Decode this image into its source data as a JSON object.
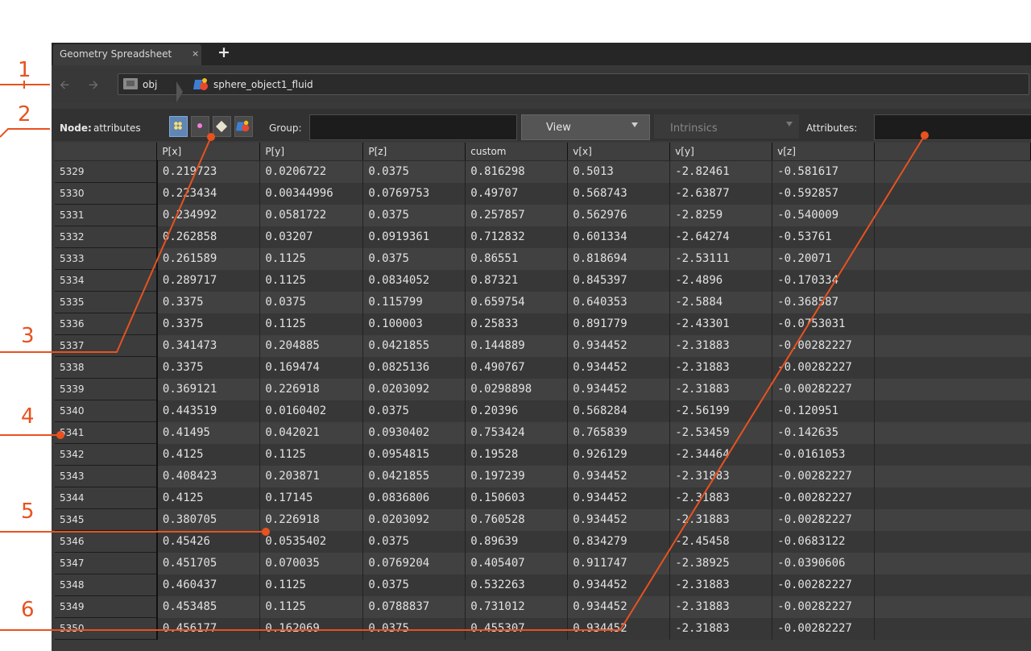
{
  "tab": {
    "label": "Geometry Spreadsheet",
    "close_glyph": "×",
    "add_glyph": "+"
  },
  "nav": {
    "back_icon": "arrow-left-icon",
    "forward_icon": "arrow-right-icon"
  },
  "path": {
    "root_label": "obj",
    "node_label": "sphere_object1_fluid"
  },
  "options": {
    "node_label": "Node:",
    "node_value": "attributes",
    "group_label": "Group:",
    "group_value": "",
    "view_label": "View",
    "intrinsics_label": "Intrinsics",
    "attributes_label": "Attributes:",
    "attributes_value": ""
  },
  "table": {
    "columns": [
      "P[x]",
      "P[y]",
      "P[z]",
      "custom",
      "v[x]",
      "v[y]",
      "v[z]"
    ],
    "rows": [
      {
        "id": "5329",
        "values": [
          "0.219723",
          "0.0206722",
          "0.0375",
          "0.816298",
          "0.5013",
          "-2.82461",
          "-0.581617"
        ]
      },
      {
        "id": "5330",
        "values": [
          "0.223434",
          "0.00344996",
          "0.0769753",
          "0.49707",
          "0.568743",
          "-2.63877",
          "-0.592857"
        ]
      },
      {
        "id": "5331",
        "values": [
          "0.234992",
          "0.0581722",
          "0.0375",
          "0.257857",
          "0.562976",
          "-2.8259",
          "-0.540009"
        ]
      },
      {
        "id": "5332",
        "values": [
          "0.262858",
          "0.03207",
          "0.0919361",
          "0.712832",
          "0.601334",
          "-2.64274",
          "-0.53761"
        ]
      },
      {
        "id": "5333",
        "values": [
          "0.261589",
          "0.1125",
          "0.0375",
          "0.86551",
          "0.818694",
          "-2.53111",
          "-0.20071"
        ]
      },
      {
        "id": "5334",
        "values": [
          "0.289717",
          "0.1125",
          "0.0834052",
          "0.87321",
          "0.845397",
          "-2.4896",
          "-0.170334"
        ]
      },
      {
        "id": "5335",
        "values": [
          "0.3375",
          "0.0375",
          "0.115799",
          "0.659754",
          "0.640353",
          "-2.5884",
          "-0.368587"
        ]
      },
      {
        "id": "5336",
        "values": [
          "0.3375",
          "0.1125",
          "0.100003",
          "0.25833",
          "0.891779",
          "-2.43301",
          "-0.0753031"
        ]
      },
      {
        "id": "5337",
        "values": [
          "0.341473",
          "0.204885",
          "0.0421855",
          "0.144889",
          "0.934452",
          "-2.31883",
          "-0.00282227"
        ]
      },
      {
        "id": "5338",
        "values": [
          "0.3375",
          "0.169474",
          "0.0825136",
          "0.490767",
          "0.934452",
          "-2.31883",
          "-0.00282227"
        ]
      },
      {
        "id": "5339",
        "values": [
          "0.369121",
          "0.226918",
          "0.0203092",
          "0.0298898",
          "0.934452",
          "-2.31883",
          "-0.00282227"
        ]
      },
      {
        "id": "5340",
        "values": [
          "0.443519",
          "0.0160402",
          "0.0375",
          "0.20396",
          "0.568284",
          "-2.56199",
          "-0.120951"
        ]
      },
      {
        "id": "5341",
        "values": [
          "0.41495",
          "0.042021",
          "0.0930402",
          "0.753424",
          "0.765839",
          "-2.53459",
          "-0.142635"
        ]
      },
      {
        "id": "5342",
        "values": [
          "0.4125",
          "0.1125",
          "0.0954815",
          "0.19528",
          "0.926129",
          "-2.34464",
          "-0.0161053"
        ]
      },
      {
        "id": "5343",
        "values": [
          "0.408423",
          "0.203871",
          "0.0421855",
          "0.197239",
          "0.934452",
          "-2.31883",
          "-0.00282227"
        ]
      },
      {
        "id": "5344",
        "values": [
          "0.4125",
          "0.17145",
          "0.0836806",
          "0.150603",
          "0.934452",
          "-2.31883",
          "-0.00282227"
        ]
      },
      {
        "id": "5345",
        "values": [
          "0.380705",
          "0.226918",
          "0.0203092",
          "0.760528",
          "0.934452",
          "-2.31883",
          "-0.00282227"
        ]
      },
      {
        "id": "5346",
        "values": [
          "0.45426",
          "0.0535402",
          "0.0375",
          "0.89639",
          "0.834279",
          "-2.45458",
          "-0.0683122"
        ]
      },
      {
        "id": "5347",
        "values": [
          "0.451705",
          "0.070035",
          "0.0769204",
          "0.405407",
          "0.911747",
          "-2.38925",
          "-0.0390606"
        ]
      },
      {
        "id": "5348",
        "values": [
          "0.460437",
          "0.1125",
          "0.0375",
          "0.532263",
          "0.934452",
          "-2.31883",
          "-0.00282227"
        ]
      },
      {
        "id": "5349",
        "values": [
          "0.453485",
          "0.1125",
          "0.0788837",
          "0.731012",
          "0.934452",
          "-2.31883",
          "-0.00282227"
        ]
      },
      {
        "id": "5350",
        "values": [
          "0.456177",
          "0.162069",
          "0.0375",
          "0.455307",
          "0.934452",
          "-2.31883",
          "-0.00282227"
        ]
      }
    ]
  },
  "callouts": [
    "1",
    "2",
    "3",
    "4",
    "5",
    "6"
  ],
  "colors": {
    "callout": "#e8521f",
    "panel_bg": "#3a3a3a",
    "row_even": "#414141",
    "row_odd": "#373737"
  }
}
